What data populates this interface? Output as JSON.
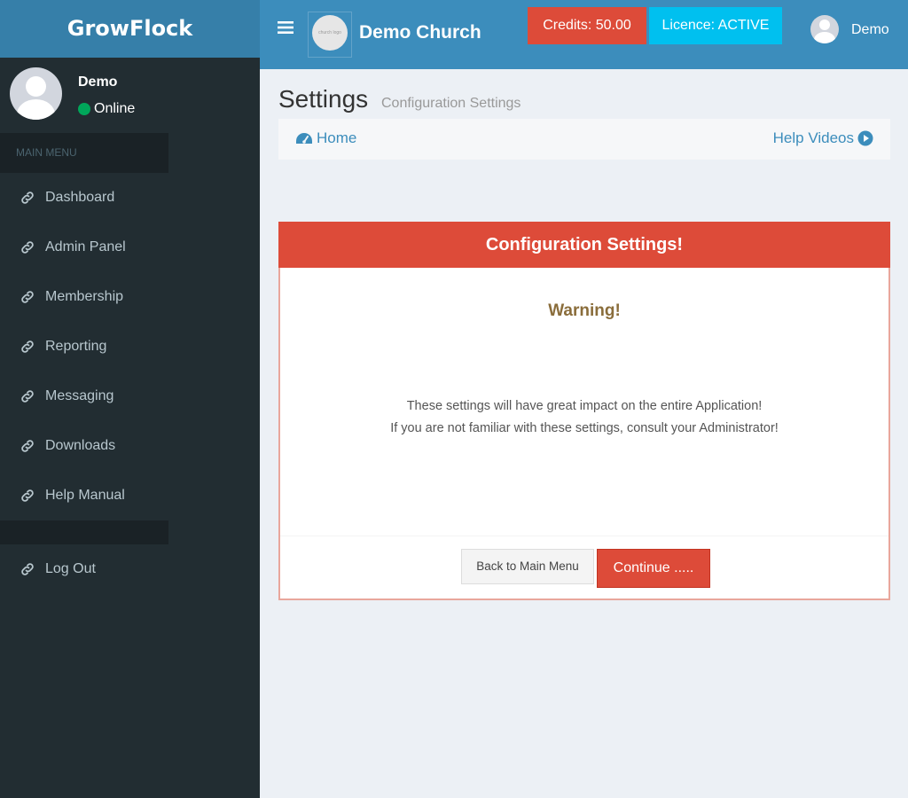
{
  "sidebar": {
    "logo": "GrowFlock",
    "user": {
      "name": "Demo",
      "status": "Online"
    },
    "menu_header": "MAIN MENU",
    "items": [
      {
        "label": "Dashboard"
      },
      {
        "label": "Admin Panel"
      },
      {
        "label": "Membership"
      },
      {
        "label": "Reporting"
      },
      {
        "label": "Messaging"
      },
      {
        "label": "Downloads"
      },
      {
        "label": "Help Manual"
      }
    ],
    "logout_label": "Log Out"
  },
  "header": {
    "org_logo_text": "church logo",
    "org_name": "Demo Church",
    "credits_label": "Credits: 50.00",
    "licence_label": "Licence: ACTIVE",
    "user_name": "Demo"
  },
  "page": {
    "title": "Settings",
    "subtitle": "Configuration Settings",
    "breadcrumb_home": "Home",
    "help_videos": "Help Videos"
  },
  "box": {
    "title": "Configuration Settings!",
    "warning_title": "Warning!",
    "message_line1": "These settings will have great impact on the entire Application!",
    "message_line2": "If you are not familiar with these settings, consult your Administrator!",
    "back_label": "Back to Main Menu",
    "continue_label": "Continue ....."
  },
  "colors": {
    "primary": "#3c8dbc",
    "sidebar": "#222d32",
    "danger": "#dd4b39",
    "info": "#00c0ef",
    "success": "#00a65a"
  }
}
